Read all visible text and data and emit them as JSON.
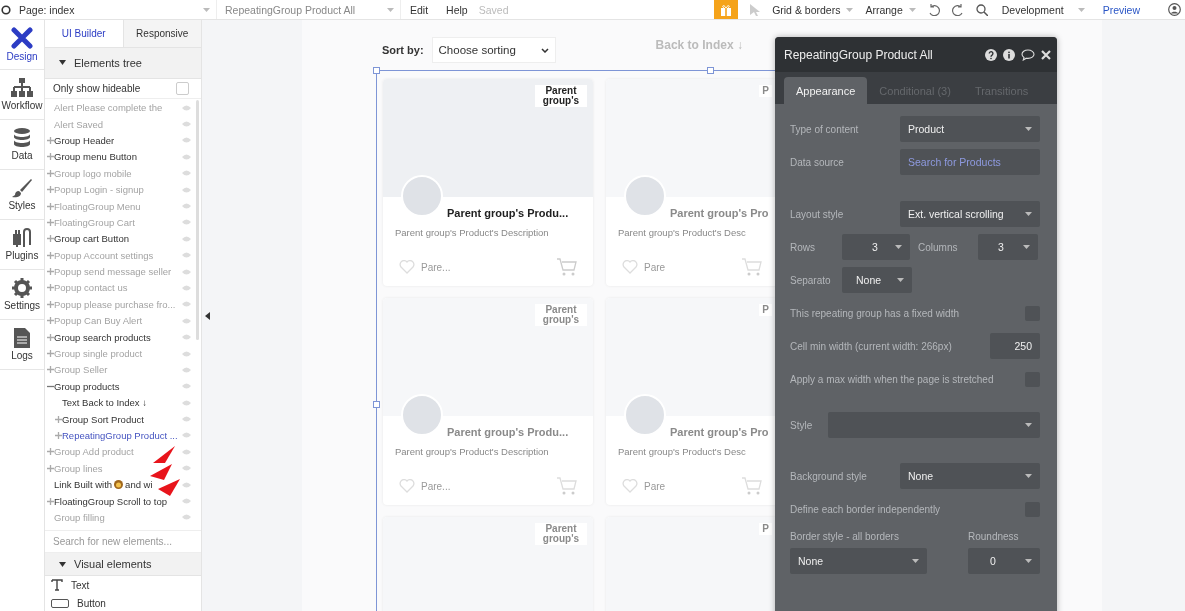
{
  "top_bar": {
    "page": "Page: index",
    "element": "RepeatingGroup Product All",
    "menu": [
      "Edit",
      "Help"
    ],
    "status": "Saved",
    "tools": [
      "Grid & borders",
      "Arrange"
    ],
    "environment": "Development",
    "preview": "Preview"
  },
  "nav": [
    {
      "label": "Design",
      "selected": true
    },
    {
      "label": "Workflow",
      "selected": false
    },
    {
      "label": "Data",
      "selected": false
    },
    {
      "label": "Styles",
      "selected": false
    },
    {
      "label": "Plugins",
      "selected": false
    },
    {
      "label": "Settings",
      "selected": false
    },
    {
      "label": "Logs",
      "selected": false
    }
  ],
  "sidebar": {
    "tabs": [
      {
        "label": "UI Builder",
        "selected": true
      },
      {
        "label": "Responsive",
        "selected": false
      }
    ],
    "tree_title": "Elements tree",
    "filter": {
      "label": "Only show hideable",
      "checked": false
    },
    "items": [
      {
        "kind": "element",
        "label": "Alert Please complete the",
        "visible": false,
        "expandable": false,
        "expanded": false,
        "selected": false
      },
      {
        "kind": "element",
        "label": "Alert Saved",
        "visible": false,
        "expandable": false,
        "expanded": false,
        "selected": false
      },
      {
        "kind": "element",
        "label": "Group Header",
        "visible": true,
        "expandable": true,
        "expanded": false,
        "selected": false
      },
      {
        "kind": "element",
        "label": "Group menu Button",
        "visible": true,
        "expandable": true,
        "expanded": false,
        "selected": false
      },
      {
        "kind": "element",
        "label": "Group logo mobile",
        "visible": false,
        "expandable": true,
        "expanded": false,
        "selected": false
      },
      {
        "kind": "element",
        "label": "Popup Login - signup",
        "visible": false,
        "expandable": true,
        "expanded": false,
        "selected": false
      },
      {
        "kind": "element",
        "label": "FloatingGroup Menu",
        "visible": false,
        "expandable": true,
        "expanded": false,
        "selected": false
      },
      {
        "kind": "element",
        "label": "FloatingGroup Cart",
        "visible": false,
        "expandable": true,
        "expanded": false,
        "selected": false
      },
      {
        "kind": "element",
        "label": "Group cart Button",
        "visible": true,
        "expandable": true,
        "expanded": false,
        "selected": false
      },
      {
        "kind": "element",
        "label": "Popup Account settings",
        "visible": false,
        "expandable": true,
        "expanded": false,
        "selected": false
      },
      {
        "kind": "element",
        "label": "Popup send message seller",
        "visible": false,
        "expandable": true,
        "expanded": false,
        "selected": false
      },
      {
        "kind": "element",
        "label": "Popup contact us",
        "visible": false,
        "expandable": true,
        "expanded": false,
        "selected": false
      },
      {
        "kind": "element",
        "label": "Popup please purchase fro...",
        "visible": false,
        "expandable": true,
        "expanded": false,
        "selected": false
      },
      {
        "kind": "element",
        "label": "Popup Can Buy Alert",
        "visible": false,
        "expandable": true,
        "expanded": false,
        "selected": false
      },
      {
        "kind": "element",
        "label": "Group search products",
        "visible": true,
        "expandable": true,
        "expanded": false,
        "selected": false
      },
      {
        "kind": "element",
        "label": "Group single product",
        "visible": false,
        "expandable": true,
        "expanded": false,
        "selected": false
      },
      {
        "kind": "element",
        "label": "Group Seller",
        "visible": false,
        "expandable": true,
        "expanded": false,
        "selected": false
      },
      {
        "kind": "element",
        "label": "Group products",
        "visible": true,
        "expandable": true,
        "expanded": true,
        "selected": false,
        "children": [
          {
            "kind": "element",
            "label": "Text Back to Index ↓",
            "visible": true,
            "expandable": false,
            "expanded": false,
            "selected": false
          },
          {
            "kind": "element",
            "label": "Group Sort Product",
            "visible": true,
            "expandable": true,
            "expanded": false,
            "selected": false
          },
          {
            "kind": "element",
            "label": "RepeatingGroup Product ...",
            "visible": true,
            "expandable": true,
            "expanded": false,
            "selected": true
          }
        ]
      },
      {
        "kind": "element",
        "label": "Group Add product",
        "visible": false,
        "expandable": true,
        "expanded": false,
        "selected": false
      },
      {
        "kind": "element",
        "label": "Group lines",
        "visible": false,
        "expandable": true,
        "expanded": false,
        "selected": false
      },
      {
        "kind": "link_with_icon",
        "label": "Link Built with",
        "label_end": "and wi",
        "visible": true,
        "expandable": false,
        "expanded": false,
        "selected": false
      },
      {
        "kind": "element",
        "label": "FloatingGroup Scroll to top",
        "visible": true,
        "expandable": true,
        "expanded": false,
        "selected": false
      },
      {
        "kind": "element",
        "label": "Group filling",
        "visible": false,
        "expandable": false,
        "expanded": false,
        "selected": false
      }
    ],
    "search": {
      "placeholder": "Search for new elements..."
    },
    "section": "Visual elements",
    "elements": [
      {
        "label": "Text"
      },
      {
        "label": "Button"
      }
    ]
  },
  "canvas": {
    "sort_label": "Sort by:",
    "sort_value": "Choose sorting",
    "back_link": "Back to Index ↓",
    "rows": [
      [
        {
          "kind": "full",
          "faded": false,
          "badge": "Parent group's",
          "title": "Parent group's Produ...",
          "description": "Parent group's Product's Description",
          "like": "Pare..."
        },
        {
          "kind": "full",
          "faded": true,
          "badge": "P",
          "title": "Parent group's Pro",
          "description": "Parent group's Product's Desc",
          "like": "Pare"
        }
      ],
      [
        {
          "kind": "full",
          "faded": true,
          "badge": "Parent group's",
          "title": "Parent group's Produ...",
          "description": "Parent group's Product's Description",
          "like": "Pare..."
        },
        {
          "kind": "full",
          "faded": true,
          "badge": "P",
          "title": "Parent group's Pro",
          "description": "Parent group's Product's Desc",
          "like": "Pare"
        }
      ],
      [
        {
          "kind": "partial",
          "faded": true,
          "badge": "Parent group's"
        },
        {
          "kind": "partial",
          "faded": true,
          "badge": "P"
        }
      ]
    ]
  },
  "panel": {
    "title": "RepeatingGroup Product All",
    "tabs": [
      {
        "label": "Appearance",
        "selected": true
      },
      {
        "label": "Conditional (3)",
        "selected": false
      },
      {
        "label": "Transitions",
        "selected": false
      }
    ],
    "fields": [
      {
        "kind": "select",
        "label": "Type of content",
        "value": "Product"
      },
      {
        "kind": "source",
        "label": "Data source",
        "value": "Search for Products"
      },
      {
        "kind": "select",
        "label": "Layout style",
        "value": "Ext. vertical scrolling"
      },
      {
        "kind": "pair",
        "label": "Rows",
        "value": "3",
        "label_2": "Columns",
        "value_2": "3"
      },
      {
        "kind": "small_select",
        "label": "Separato",
        "value": "None"
      },
      {
        "kind": "checkbox",
        "label": "This repeating group has a fixed width",
        "checked": false
      },
      {
        "kind": "number",
        "label": "Cell min width (current width: 266px)",
        "value": "250"
      },
      {
        "kind": "checkbox",
        "label": "Apply a max width when the page is stretched",
        "checked": false
      },
      {
        "kind": "wide_select",
        "label": "Style"
      },
      {
        "kind": "select",
        "label": "Background style",
        "value": "None"
      },
      {
        "kind": "checkbox",
        "label": "Define each border independently",
        "checked": false
      },
      {
        "kind": "border",
        "label": "Border style - all borders",
        "value": "None",
        "label_2": "Roundness",
        "value_2": "0"
      }
    ]
  }
}
